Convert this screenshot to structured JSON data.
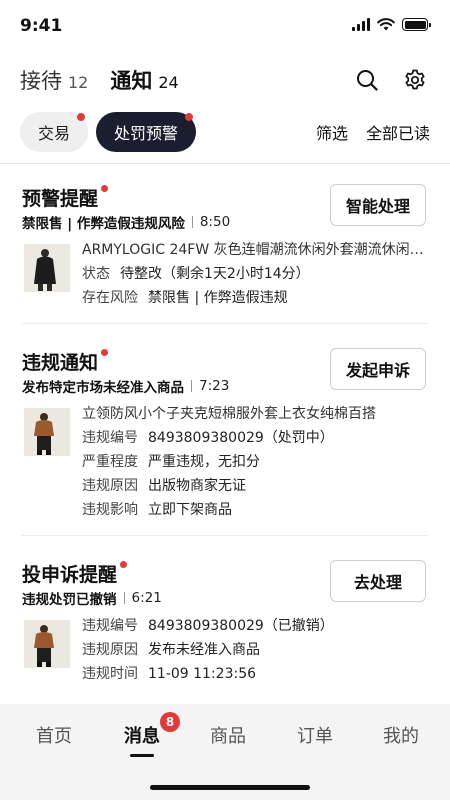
{
  "status_bar": {
    "time": "9:41"
  },
  "top_nav": {
    "tabs": [
      {
        "label": "接待",
        "count": "12"
      },
      {
        "label": "通知",
        "count": "24"
      }
    ]
  },
  "filters": {
    "chips": [
      {
        "label": "交易"
      },
      {
        "label": "处罚预警"
      }
    ],
    "filter_label": "筛选",
    "read_all_label": "全部已读"
  },
  "cards": [
    {
      "title": "预警提醒",
      "subtitle": "禁限售 | 作弊造假违规风险",
      "time": "8:50",
      "button": "智能处理",
      "product_title": "ARMYLOGIC 24FW 灰色连帽潮流休闲外套潮流休闲外套",
      "rows": [
        {
          "key": "状态",
          "value": "待整改（剩余1天2小时14分）"
        },
        {
          "key": "存在风险",
          "value": "禁限售 | 作弊造假违规"
        }
      ]
    },
    {
      "title": "违规通知",
      "subtitle": "发布特定市场未经准入商品",
      "time": "7:23",
      "button": "发起申诉",
      "product_title": "立领防风小个子夹克短棉服外套上衣女纯棉百搭",
      "rows": [
        {
          "key": "违规编号",
          "value": "8493809380029（处罚中）"
        },
        {
          "key": "严重程度",
          "value": "严重违规，无扣分"
        },
        {
          "key": "违规原因",
          "value": "出版物商家无证"
        },
        {
          "key": "违规影响",
          "value": "立即下架商品"
        }
      ]
    },
    {
      "title": "投申诉提醒",
      "subtitle": "违规处罚已撤销",
      "time": "6:21",
      "button": "去处理",
      "rows": [
        {
          "key": "违规编号",
          "value": "8493809380029（已撤销）"
        },
        {
          "key": "违规原因",
          "value": "发布未经准入商品"
        },
        {
          "key": "违规时间",
          "value": "11-09 11:23:56"
        }
      ]
    }
  ],
  "tab_bar": {
    "items": [
      {
        "label": "首页"
      },
      {
        "label": "消息",
        "badge": "8"
      },
      {
        "label": "商品"
      },
      {
        "label": "订单"
      },
      {
        "label": "我的"
      }
    ]
  },
  "colors": {
    "accent_red": "#e23a3a",
    "active_chip": "#1b1e2e"
  }
}
